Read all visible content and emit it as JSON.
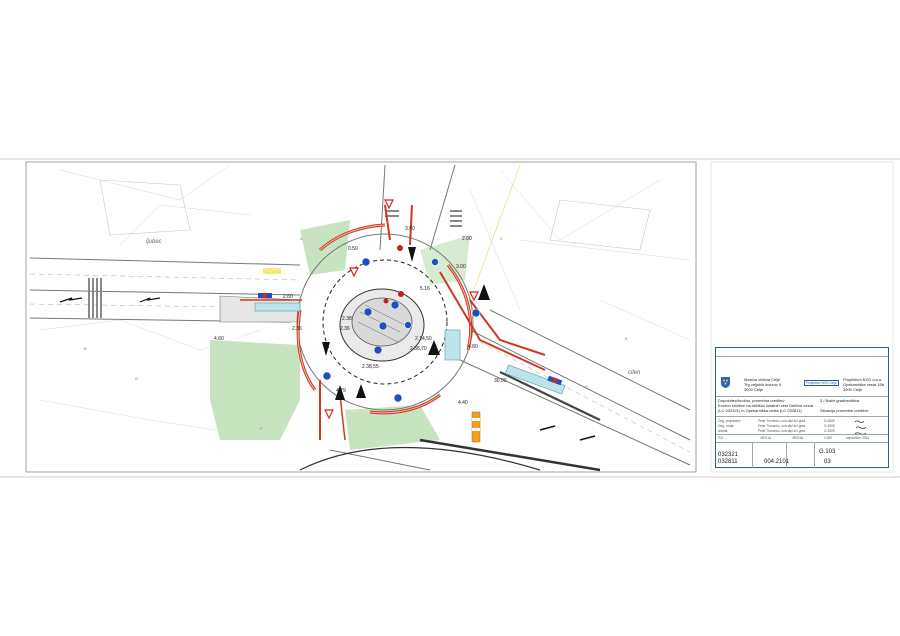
{
  "drawing": {
    "dimensions": [
      "2.60",
      "3.50",
      "4.60",
      "2.36",
      "2.36",
      "2.00",
      "3.00",
      "5.16",
      "0.50",
      "2.38",
      "4.80",
      "4.79",
      "2.38,55",
      "2.38,70",
      "2.14,50",
      "30,00",
      "4.40"
    ],
    "street_labels": [
      "ljubec",
      "cilen"
    ],
    "markings": [
      "A",
      "B",
      "C",
      "D",
      "E",
      "F",
      "G"
    ]
  },
  "title_block": {
    "header_cells": [
      "",
      "",
      "",
      "",
      ""
    ],
    "investor_name": "Mestna občina Celje",
    "investor_addr1": "Trg celjskih knezov 9",
    "investor_addr2": "3000 Celje",
    "designer_name": "Projektivni NVG d.o.o.",
    "designer_addr1": "Opekarniška cesta 15b",
    "designer_addr2": "3000 Celje",
    "designer_badge": "Projektivni NVG Celje",
    "project_line1": "Dopolnitev/krožno, prometna ureditev",
    "project_line2": "Krožno križišče na stičišču lokalnih cest Delčiva cesta",
    "project_line3": "(LC 032321) in Opekarniška cesta (LC 032811)",
    "part_label": "3 / Načrt gradbeništva",
    "content_label": "Situacija prometne ureditve",
    "persons": [
      "Peter Trocenko, univ.dipl.inž.grad.",
      "Peter Trocenko, univ.dipl.inž.grad.",
      "Peter Trocenko, univ.dipl.inž.grad."
    ],
    "licenses": [
      "G-3505",
      "G-3505",
      "G-3505"
    ],
    "row_labels": [
      "Odg. projektant:",
      "Odg. vodja:",
      "Izdelal:"
    ],
    "phase": "PZI",
    "project_no_label": "4R2118",
    "scale_label": "4R2118",
    "scale": "1:250",
    "date": "september 2020",
    "sheet_no": "G.103",
    "road_ids": [
      "032321",
      "032811"
    ],
    "project_code": "004.2101",
    "revision": "03"
  }
}
